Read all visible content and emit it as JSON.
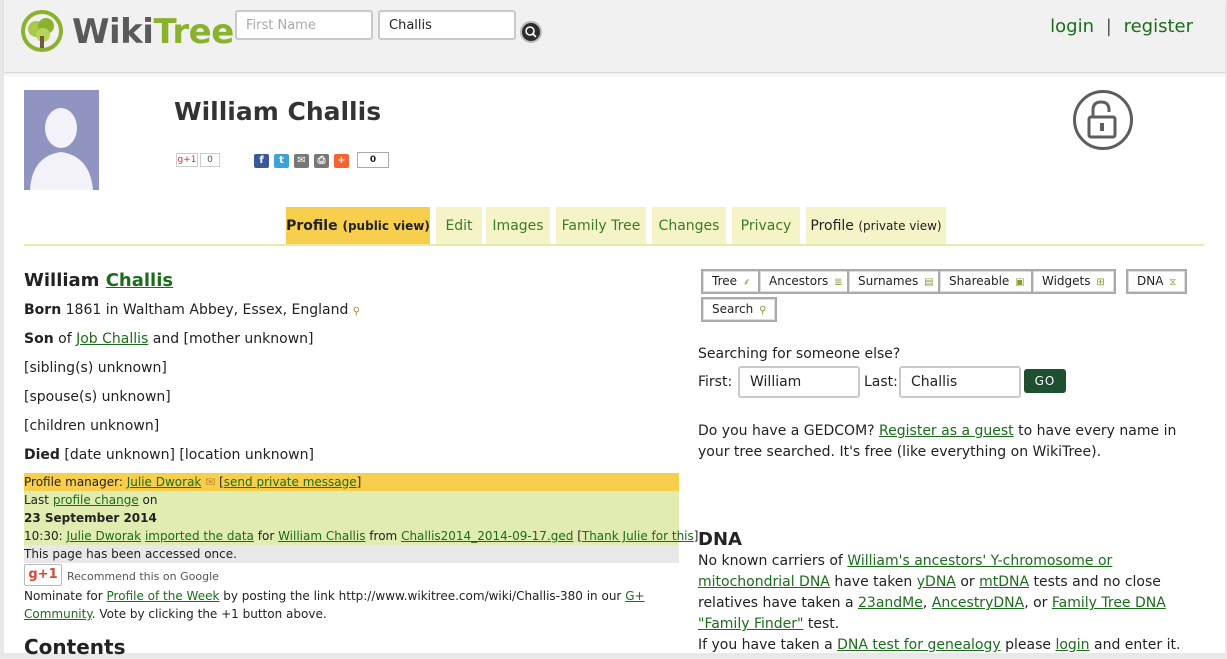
{
  "header": {
    "logo_text_wiki": "Wiki",
    "logo_text_tree": "Tree",
    "first_name_placeholder": "First Name",
    "last_name_value": "Challis",
    "login_label": "login",
    "separator": "|",
    "register_label": "register"
  },
  "profile": {
    "title": "William Challis",
    "gplus_count": "0",
    "share_count": "0"
  },
  "tabs": [
    {
      "label": "Profile",
      "sub": "(public view)"
    },
    {
      "label": "Edit"
    },
    {
      "label": "Images"
    },
    {
      "label": "Family Tree"
    },
    {
      "label": "Changes"
    },
    {
      "label": "Privacy"
    },
    {
      "label": "Profile",
      "sub": "(private view)"
    }
  ],
  "bio": {
    "first": "William",
    "last": "Challis",
    "born_label": "Born",
    "born_text": "1861 in Waltham Abbey, Essex, England",
    "son_label": "Son",
    "son_of": "of",
    "father": "Job Challis",
    "and_mother": "and [mother unknown]",
    "siblings": "[sibling(s) unknown]",
    "spouses": "[spouse(s) unknown]",
    "children": "[children unknown]",
    "died_label": "Died",
    "died_text": "[date unknown] [location unknown]"
  },
  "manager": {
    "label": "Profile manager:",
    "name": "Julie Dworak",
    "send_msg": "send private message",
    "last_label": "Last",
    "profile_change": "profile change",
    "on": "on",
    "date": "23 September 2014",
    "time": "10:30:",
    "user": "Julie Dworak",
    "imported": "imported the data",
    "for": "for",
    "subject": "William Challis",
    "from": "from",
    "file": "Challis2014_2014-09-17.ged",
    "thank": "Thank Julie for this",
    "accessed": "This page has been accessed once."
  },
  "google": {
    "button": "g+1",
    "recommend": "Recommend this on Google"
  },
  "nominate": {
    "prefix": "Nominate for",
    "potw": "Profile of the Week",
    "middle": "by posting the link http://www.wikitree.com/wiki/Challis-380 in our",
    "community": "G+ Community",
    "suffix": ". Vote by clicking the +1 button above."
  },
  "contents_heading": "Contents",
  "tools": [
    {
      "label": "Tree",
      "icon": "tree-icon"
    },
    {
      "label": "Ancestors",
      "icon": "list-icon"
    },
    {
      "label": "Surnames",
      "icon": "list-icon"
    },
    {
      "label": "Shareable",
      "icon": "share-icon"
    },
    {
      "label": "Widgets",
      "icon": "widget-icon"
    },
    {
      "label": "DNA",
      "icon": "dna-icon"
    },
    {
      "label": "Search",
      "icon": "magnifier-icon"
    }
  ],
  "search_else": {
    "heading": "Searching for someone else?",
    "first_label": "First:",
    "first_value": "William",
    "last_label": "Last:",
    "last_value": "Challis",
    "go": "GO"
  },
  "gedcom": {
    "prefix": "Do you have a GEDCOM?",
    "link": "Register as a guest",
    "suffix": "to have every name in your tree searched. It's free (like everything on WikiTree)."
  },
  "dna": {
    "heading": "DNA",
    "p1_a": "No known carriers of",
    "p1_link": "William's ancestors' Y-chromosome or mitochondrial DNA",
    "p1_b": "have taken",
    "ydna": "yDNA",
    "or1": "or",
    "mtdna": "mtDNA",
    "p1_c": "tests and no close relatives have taken a",
    "t23": "23andMe",
    "comma": ",",
    "ancestrydna": "AncestryDNA",
    "or2": ", or",
    "ftdna": "Family Tree DNA \"Family Finder\"",
    "test_end": "test.",
    "p2_a": "If you have taken a",
    "p2_link": "DNA test for genealogy",
    "p2_b": "please",
    "login": "login",
    "p2_c": "and enter it."
  }
}
